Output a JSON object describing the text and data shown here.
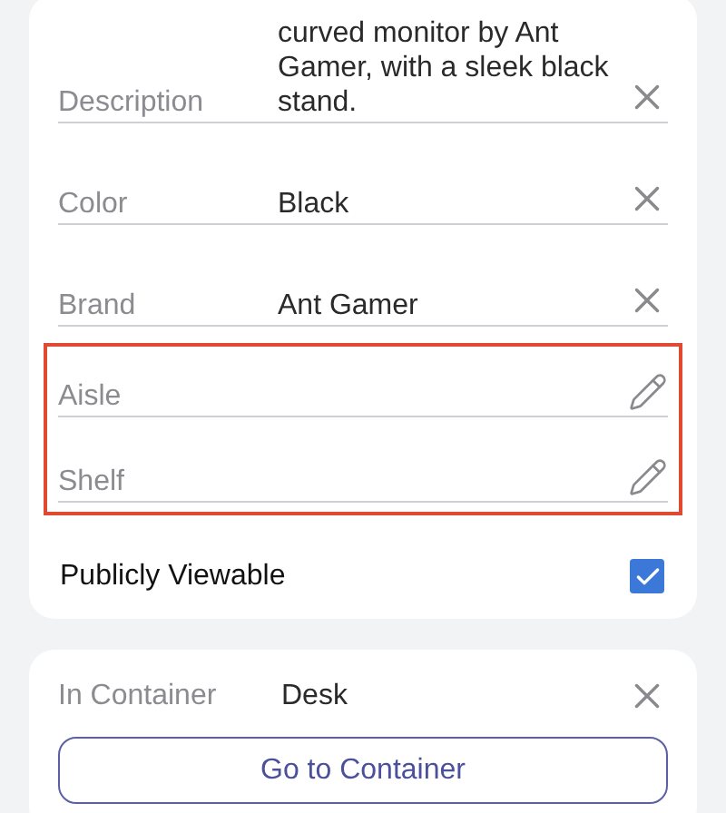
{
  "fields": [
    {
      "label": "Description",
      "value": "curved monitor by Ant Gamer, with a sleek black stand.",
      "kind": "clear",
      "highlighted": false
    },
    {
      "label": "Color",
      "value": "Black",
      "kind": "clear",
      "highlighted": false
    },
    {
      "label": "Brand",
      "value": "Ant Gamer",
      "kind": "clear",
      "highlighted": false
    },
    {
      "label": "Aisle",
      "kind": "edit",
      "highlighted": true
    },
    {
      "label": "Shelf",
      "kind": "edit",
      "highlighted": true
    }
  ],
  "publicly_viewable": {
    "label": "Publicly Viewable",
    "checked": true
  },
  "container": {
    "label": "In Container",
    "value": "Desk",
    "button": "Go to Container"
  }
}
